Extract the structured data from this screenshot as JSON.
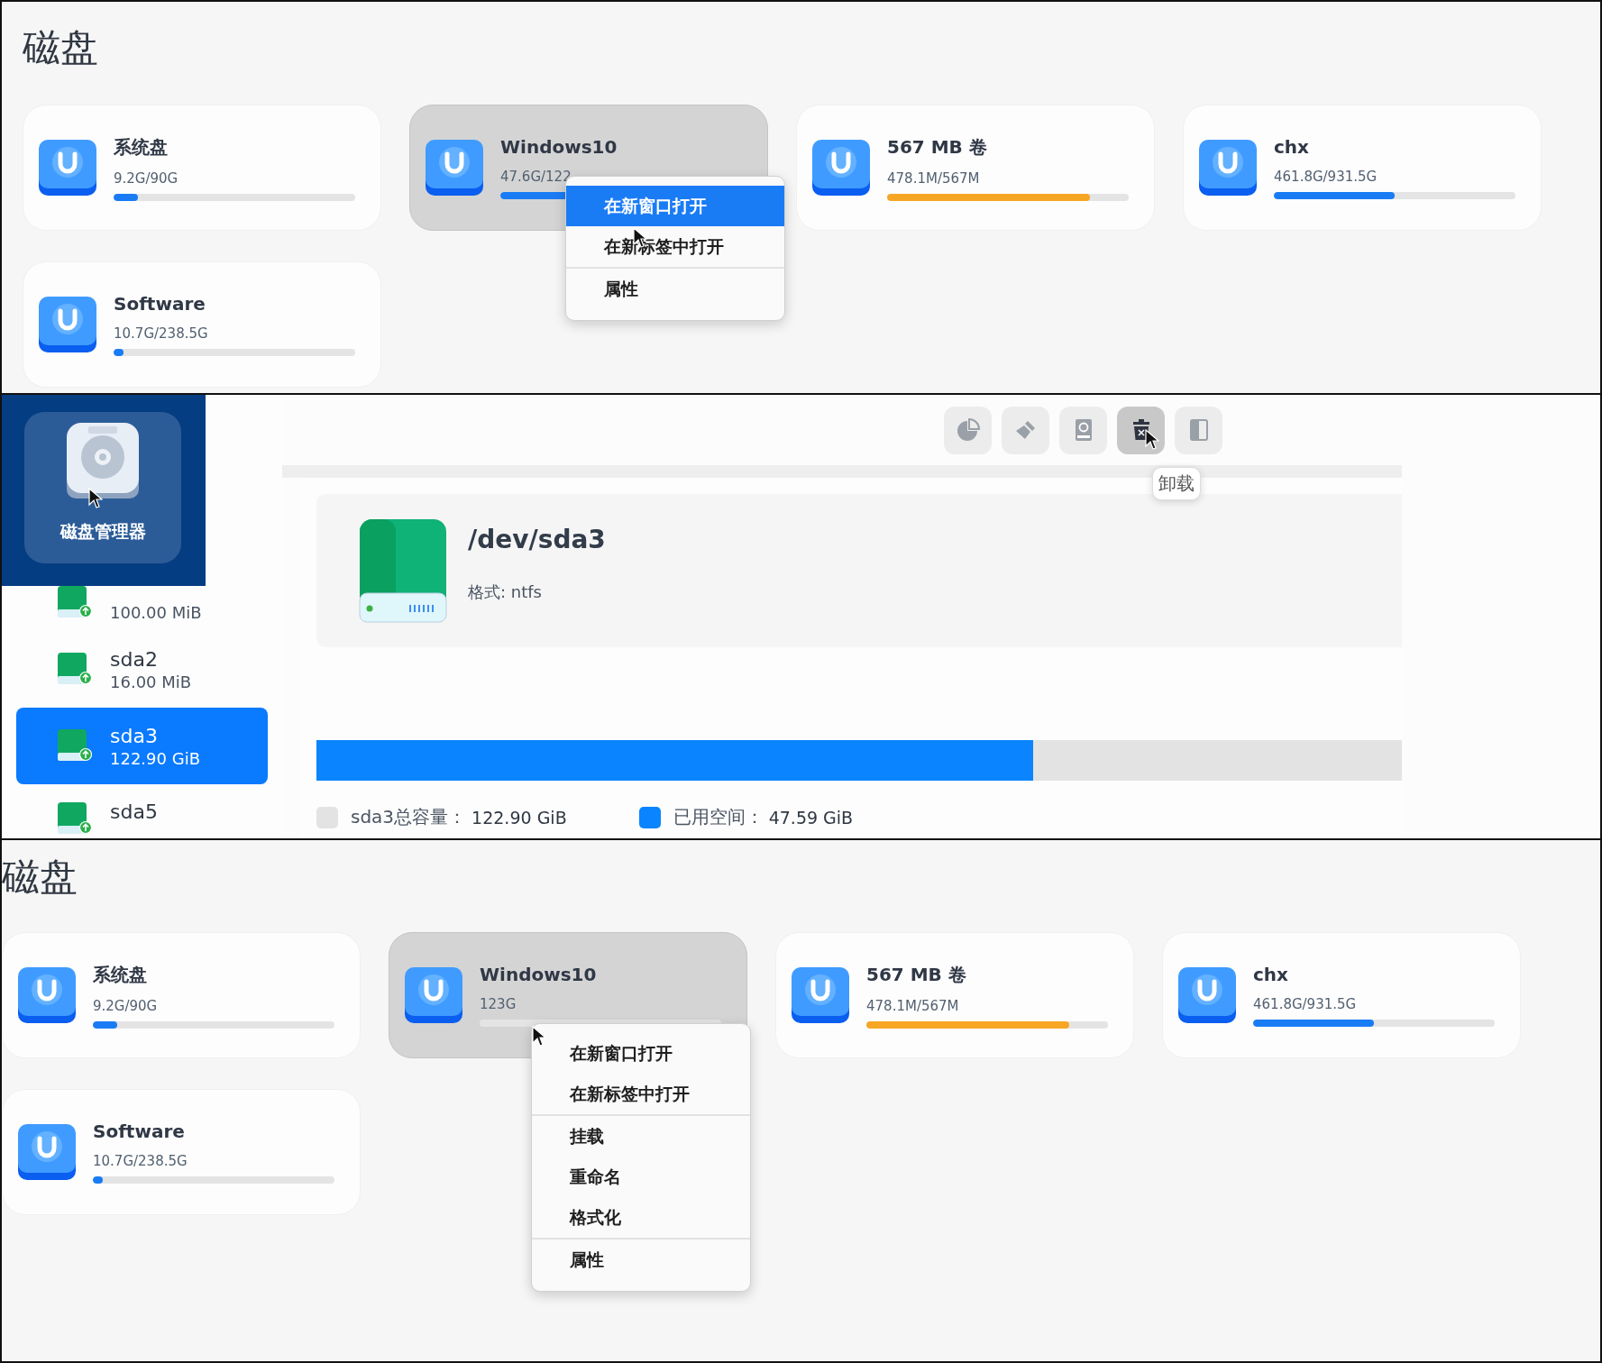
{
  "disk_view_top": {
    "title": "磁盘",
    "volumes": [
      {
        "name": "系统盘",
        "usage": "9.2G/90G",
        "level": 0.1,
        "color": "#1a7cf5",
        "selected": false
      },
      {
        "name": "Windows10",
        "usage": "47.6G/122",
        "level": 0.39,
        "color": "#1a7cf5",
        "selected": true
      },
      {
        "name": "567 MB 卷",
        "usage": "478.1M/567M",
        "level": 0.84,
        "color": "#f6a623",
        "selected": false
      },
      {
        "name": "chx",
        "usage": "461.8G/931.5G",
        "level": 0.5,
        "color": "#1a7cf5",
        "selected": false
      },
      {
        "name": "Software",
        "usage": "10.7G/238.5G",
        "level": 0.04,
        "color": "#1a7cf5",
        "selected": false
      }
    ],
    "context_menu": {
      "items": [
        {
          "label": "在新窗口打开",
          "selected": true,
          "separator_before": false
        },
        {
          "label": "在新标签中打开",
          "selected": false,
          "separator_before": false
        },
        {
          "label": "属性",
          "selected": false,
          "separator_before": true
        }
      ]
    }
  },
  "partition_manager": {
    "launcher": {
      "label": "磁盘管理器"
    },
    "toolbar": [
      {
        "kind": "pie",
        "active": false
      },
      {
        "kind": "brush",
        "active": false
      },
      {
        "kind": "refresh",
        "active": false
      },
      {
        "kind": "unmount",
        "active": true
      },
      {
        "kind": "split",
        "active": false
      }
    ],
    "tooltip": "卸载",
    "partitions": [
      {
        "size": "100.00 MiB",
        "selected": false
      },
      {
        "name": "sda2",
        "size": "16.00 MiB",
        "selected": false
      },
      {
        "name": "sda3",
        "size": "122.90 GiB",
        "selected": true
      },
      {
        "name": "sda5",
        "selected": false
      }
    ],
    "detail": {
      "path": "/dev/sda3",
      "format": "格式: ntfs",
      "level": 0.66,
      "legend": [
        {
          "label": "sda3总容量：",
          "value": "122.90 GiB",
          "color": "#e3e3e3"
        },
        {
          "label": "已用空间：",
          "value": "47.59 GiB",
          "color": "#0a84ff"
        }
      ]
    }
  },
  "disk_view_bottom": {
    "title": "磁盘",
    "volumes": [
      {
        "name": "系统盘",
        "usage": "9.2G/90G",
        "level": 0.1,
        "color": "#1a7cf5",
        "selected": false
      },
      {
        "name": "Windows10",
        "usage": "123G",
        "selected": true
      },
      {
        "name": "567 MB 卷",
        "usage": "478.1M/567M",
        "level": 0.84,
        "color": "#f6a623",
        "selected": false
      },
      {
        "name": "chx",
        "usage": "461.8G/931.5G",
        "level": 0.5,
        "color": "#1a7cf5",
        "selected": false
      },
      {
        "name": "Software",
        "usage": "10.7G/238.5G",
        "level": 0.04,
        "color": "#1a7cf5",
        "selected": false
      }
    ],
    "context_menu": {
      "items": [
        {
          "label": "在新窗口打开",
          "selected": false,
          "separator_before": false
        },
        {
          "label": "在新标签中打开",
          "selected": false,
          "separator_before": false
        },
        {
          "label": "挂载",
          "selected": false,
          "separator_before": true
        },
        {
          "label": "重命名",
          "selected": false,
          "separator_before": false
        },
        {
          "label": "格式化",
          "selected": false,
          "separator_before": false
        },
        {
          "label": "属性",
          "selected": false,
          "separator_before": true
        }
      ]
    }
  }
}
